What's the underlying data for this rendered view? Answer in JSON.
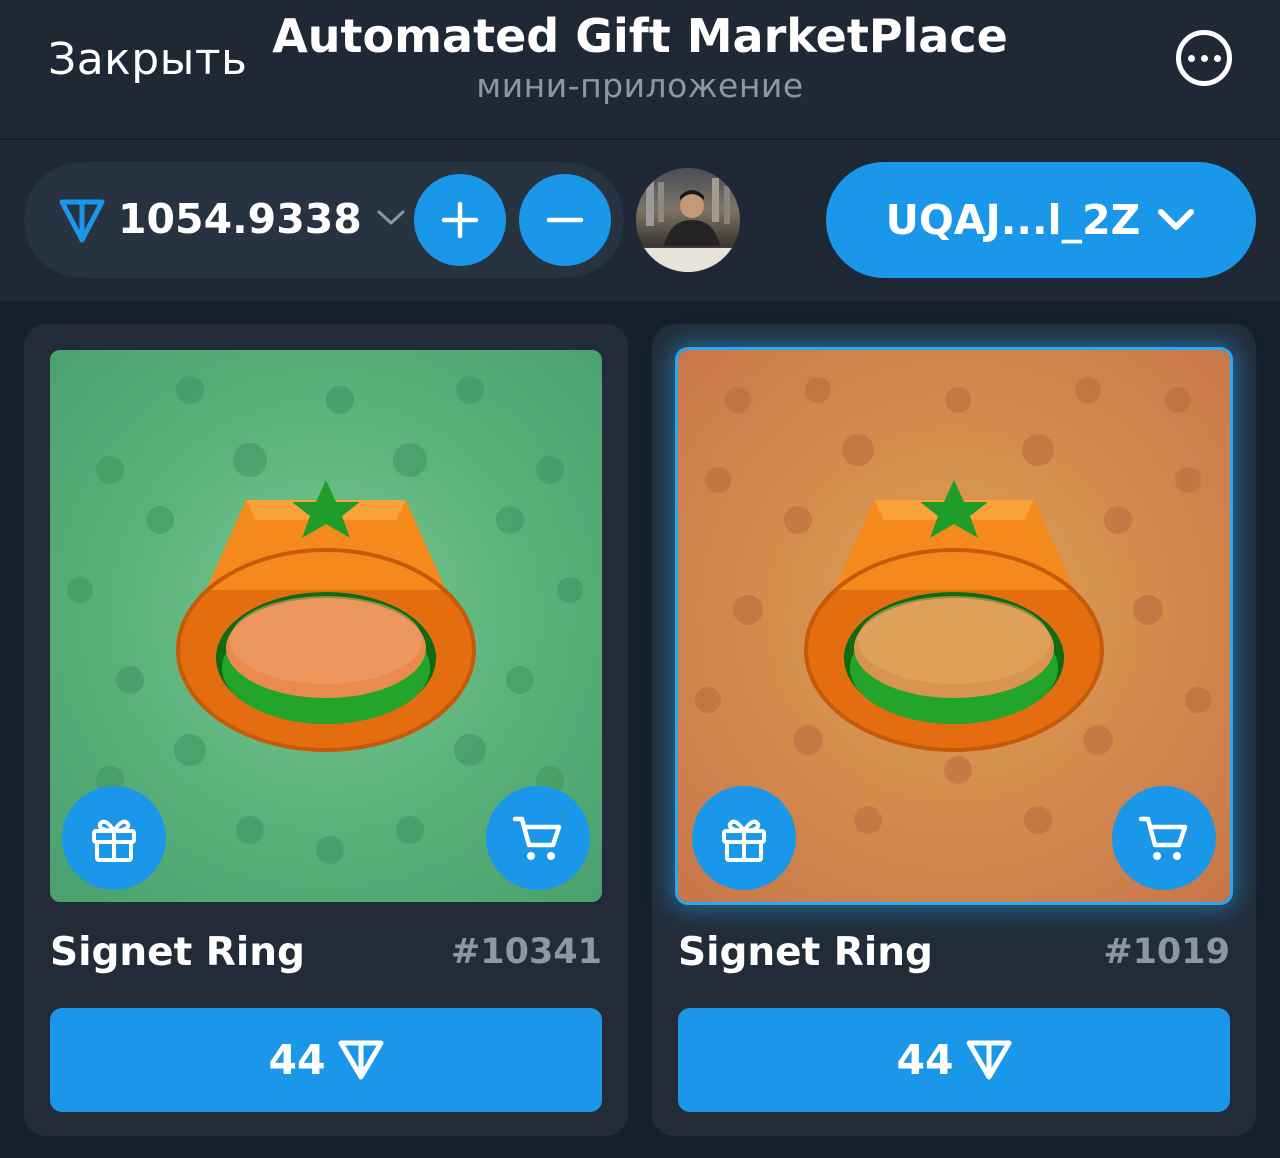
{
  "header": {
    "close_label": "Закрыть",
    "title": "Automated Gift MarketPlace",
    "subtitle": "мини-приложение",
    "more_icon": "more-horizontal-icon"
  },
  "toolbar": {
    "balance": "1054.9338",
    "currency_icon": "ton-icon",
    "add_icon": "plus-icon",
    "remove_icon": "minus-icon",
    "wallet_label": "UQAJ...l_2Z"
  },
  "gifts": [
    {
      "name": "Signet Ring",
      "number": "#10341",
      "price": "44",
      "background": "green",
      "selected": false
    },
    {
      "name": "Signet Ring",
      "number": "#1019",
      "price": "44",
      "background": "orange",
      "selected": true
    }
  ],
  "colors": {
    "accent": "#1a97e8",
    "background": "#161f2b",
    "panel": "#1f2936",
    "card": "#222c39",
    "muted_text": "#8d96a3"
  }
}
